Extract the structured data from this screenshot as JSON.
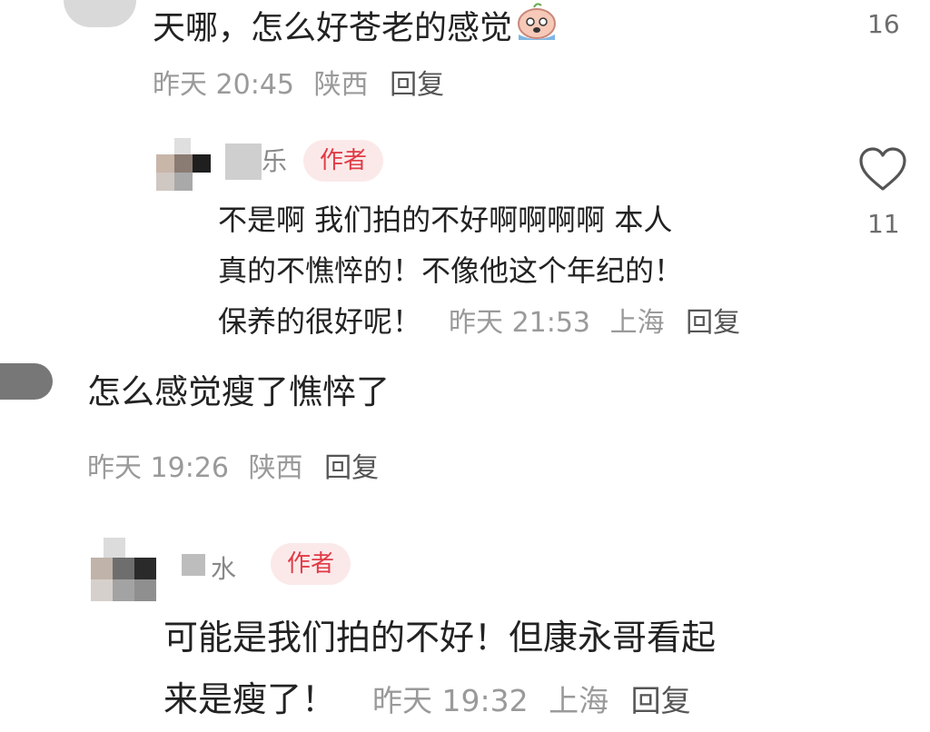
{
  "comments": [
    {
      "text": "天哪，怎么好苍老的感觉",
      "emoji_icon": "crying-face-emoji",
      "date": "昨天",
      "time": "20:45",
      "location": "陕西",
      "reply_label": "回复",
      "like_count": "16"
    },
    {
      "author_partial": "乐",
      "author_badge": "作者",
      "text_lines": [
        "不是啊 我们拍的不好啊啊啊啊 本人",
        "真的不憔悴的！不像他这个年纪的！",
        "保养的很好呢！"
      ],
      "date": "昨天",
      "time": "21:53",
      "location": "上海",
      "reply_label": "回复",
      "like_icon": "heart-outline-icon",
      "like_count": "11"
    },
    {
      "text": "怎么感觉瘦了憔悴了",
      "date": "昨天",
      "time": "19:26",
      "location": "陕西",
      "reply_label": "回复"
    },
    {
      "author_partial": "水",
      "author_badge": "作者",
      "text_lines": [
        "可能是我们拍的不好！但康永哥看起",
        "来是瘦了！"
      ],
      "date": "昨天",
      "time": "19:32",
      "location": "上海",
      "reply_label": "回复"
    }
  ],
  "colors": {
    "badge_bg": "#fbe9ea",
    "badge_text": "#e03b45",
    "meta_text": "#9a9a9a"
  }
}
